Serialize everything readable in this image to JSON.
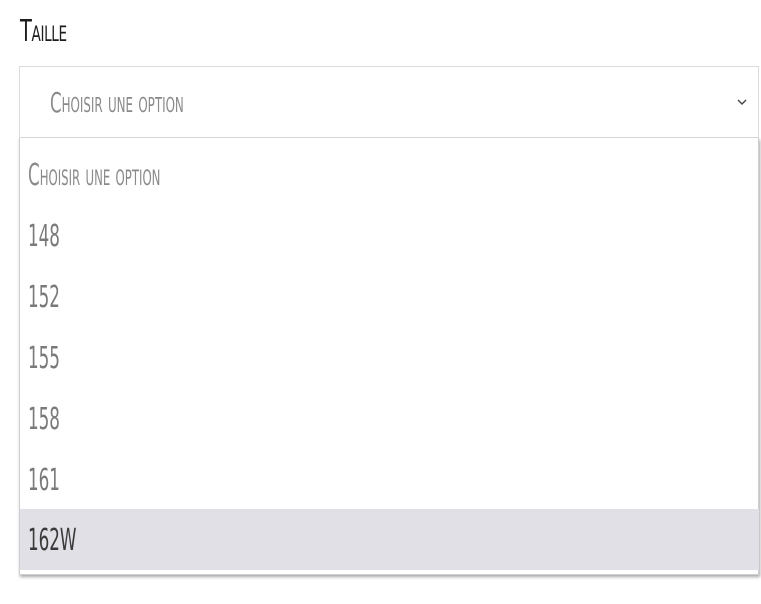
{
  "field": {
    "label": "Taille",
    "placeholder": "Choisir une option"
  },
  "dropdown": {
    "options": [
      {
        "label": "Choisir une option"
      },
      {
        "label": "148"
      },
      {
        "label": "152"
      },
      {
        "label": "155"
      },
      {
        "label": "158"
      },
      {
        "label": "161"
      },
      {
        "label": "162W",
        "highlighted": true
      }
    ],
    "highlight_color": "#e1e0e6"
  }
}
